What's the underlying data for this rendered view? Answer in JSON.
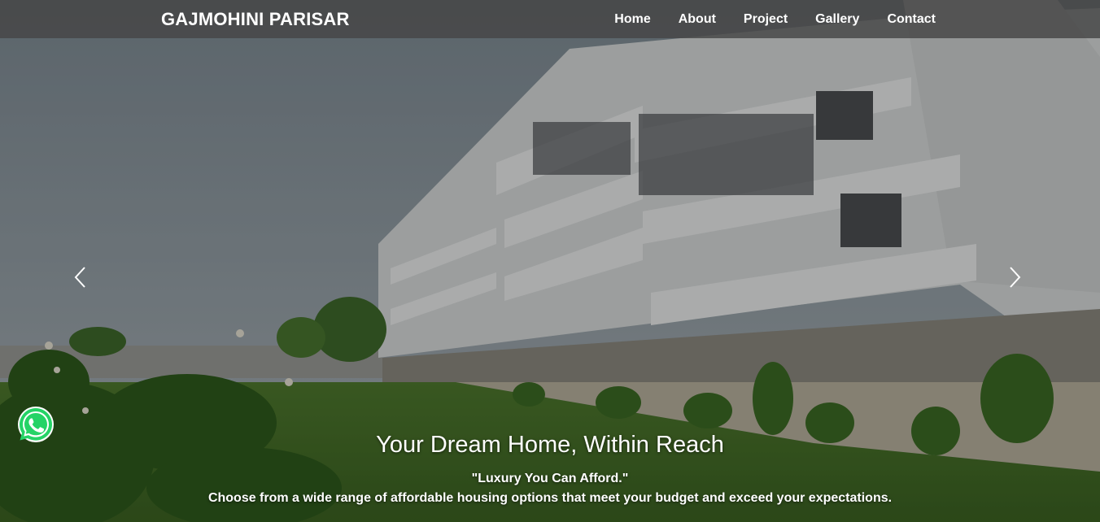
{
  "navbar": {
    "brand": "GAJMOHINI PARISAR",
    "links": [
      "Home",
      "About",
      "Project",
      "Gallery",
      "Contact"
    ]
  },
  "hero": {
    "title": "Your Dream Home, Within Reach",
    "tagline": "\"Luxury You Can Afford.\"",
    "description": "Choose from a wide range of affordable housing options that meet your budget and exceed your expectations."
  },
  "controls": {
    "prev_icon": "chevron-left-icon",
    "next_icon": "chevron-right-icon",
    "whatsapp_icon": "whatsapp-icon"
  },
  "colors": {
    "navbar_bg": "#464646",
    "text": "#ffffff",
    "whatsapp_green": "#25d366"
  }
}
